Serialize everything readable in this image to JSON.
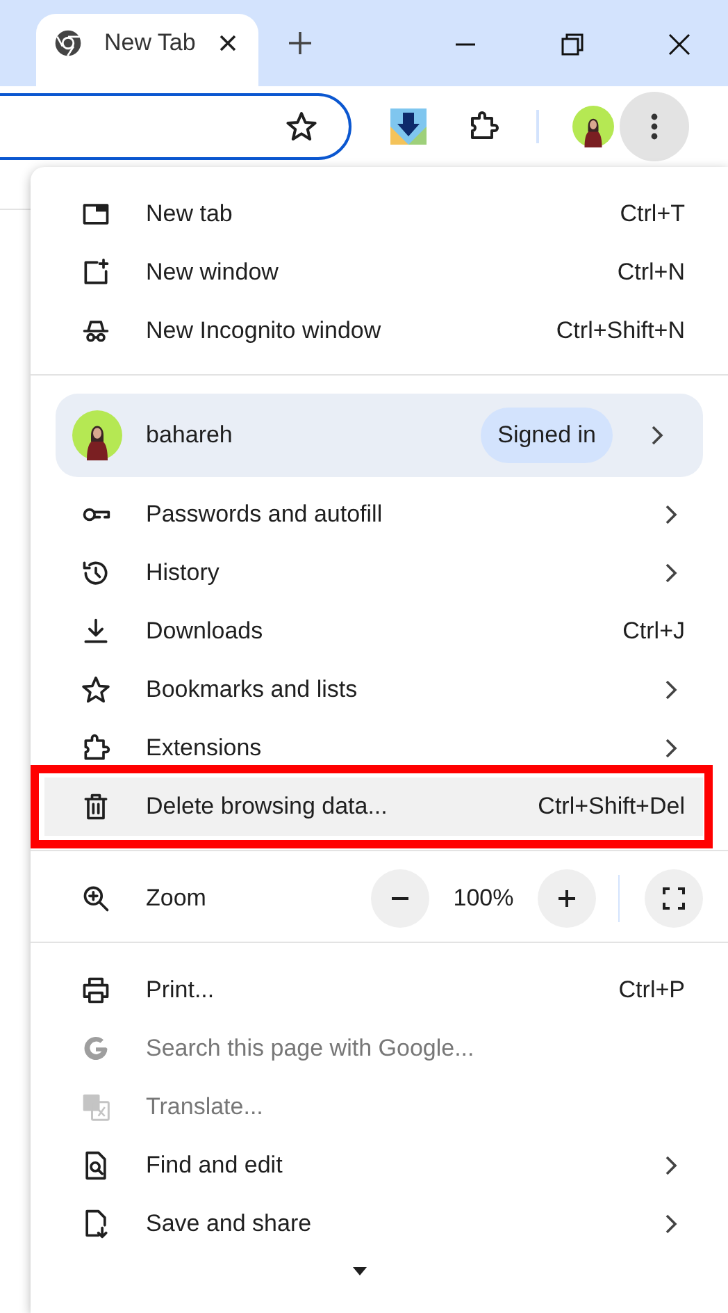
{
  "tab_strip": {
    "tabs": [
      {
        "title": "New Tab",
        "selected": true
      }
    ]
  },
  "menu": {
    "groups": [
      {
        "items": [
          {
            "label": "New tab",
            "shortcut": "Ctrl+T",
            "submenu": false,
            "disabled": false,
            "highlighted": false
          },
          {
            "label": "New window",
            "shortcut": "Ctrl+N",
            "submenu": false,
            "disabled": false,
            "highlighted": false
          },
          {
            "label": "New Incognito window",
            "shortcut": "Ctrl+Shift+N",
            "submenu": false,
            "disabled": false,
            "highlighted": false
          }
        ]
      },
      {
        "profile": {
          "name": "bahareh",
          "status": "Signed in"
        },
        "items": [
          {
            "label": "Passwords and autofill",
            "submenu": true,
            "disabled": false,
            "highlighted": false
          },
          {
            "label": "History",
            "submenu": true,
            "disabled": false,
            "highlighted": false
          },
          {
            "label": "Downloads",
            "shortcut": "Ctrl+J",
            "submenu": false,
            "disabled": false,
            "highlighted": false
          },
          {
            "label": "Bookmarks and lists",
            "submenu": true,
            "disabled": false,
            "highlighted": false
          },
          {
            "label": "Extensions",
            "submenu": true,
            "disabled": false,
            "highlighted": false
          },
          {
            "label": "Delete browsing data...",
            "shortcut": "Ctrl+Shift+Del",
            "submenu": false,
            "disabled": false,
            "highlighted": true
          }
        ]
      },
      {
        "zoom": {
          "label": "Zoom",
          "value": "100%"
        }
      },
      {
        "items": [
          {
            "label": "Print...",
            "shortcut": "Ctrl+P",
            "submenu": false,
            "disabled": false,
            "highlighted": false
          },
          {
            "label": "Search this page with Google...",
            "submenu": false,
            "disabled": true,
            "highlighted": false
          },
          {
            "label": "Translate...",
            "submenu": false,
            "disabled": true,
            "highlighted": false
          },
          {
            "label": "Find and edit",
            "submenu": true,
            "disabled": false,
            "highlighted": false
          },
          {
            "label": "Save and share",
            "submenu": true,
            "disabled": false,
            "highlighted": false
          }
        ]
      }
    ]
  }
}
